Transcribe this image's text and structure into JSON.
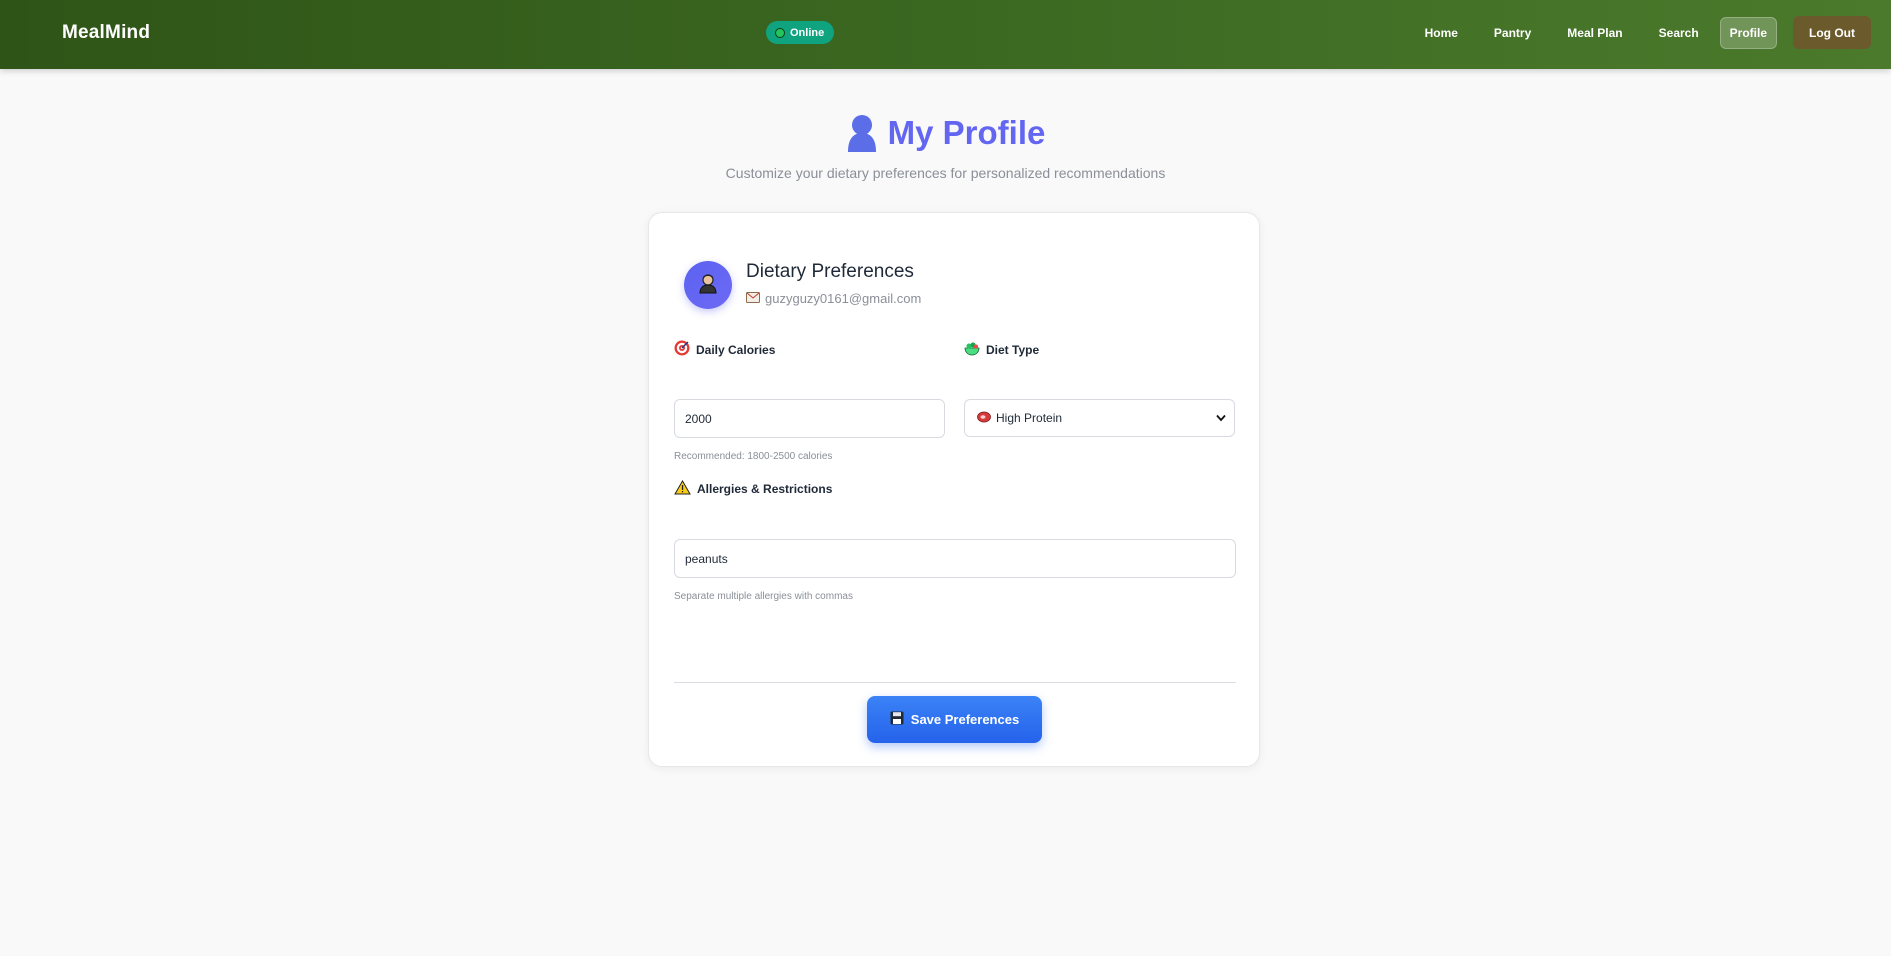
{
  "app": {
    "brand": "MealMind",
    "status": "Online"
  },
  "nav": {
    "items": [
      {
        "label": "Home"
      },
      {
        "label": "Pantry"
      },
      {
        "label": "Meal Plan"
      },
      {
        "label": "Search"
      },
      {
        "label": "Profile",
        "active": true
      }
    ],
    "logout_label": "Log Out"
  },
  "hero": {
    "title": "My Profile",
    "subtitle": "Customize your dietary preferences for personalized recommendations"
  },
  "card": {
    "title": "Dietary Preferences",
    "email": "guzyguzy0161@gmail.com"
  },
  "form": {
    "calories": {
      "label": "Daily Calories",
      "value": "2000",
      "helper": "Recommended: 1800-2500 calories"
    },
    "diet": {
      "label": "Diet Type",
      "selected": "High Protein"
    },
    "allergies": {
      "label": "Allergies & Restrictions",
      "value": "peanuts",
      "helper": "Separate multiple allergies with commas"
    },
    "save_label": "Save Preferences"
  },
  "icons": {
    "user": "user-silhouette-icon",
    "avatar": "person-icon",
    "email": "envelope-icon",
    "calories": "target-icon",
    "diet": "salad-icon",
    "diet_option": "meat-icon",
    "allergies": "warning-icon",
    "save": "floppy-disk-icon"
  },
  "colors": {
    "header_start": "#2f5417",
    "header_end": "#4c7a2c",
    "accent": "#6366f1",
    "online": "#10a37f",
    "save_button": "#2563eb"
  }
}
